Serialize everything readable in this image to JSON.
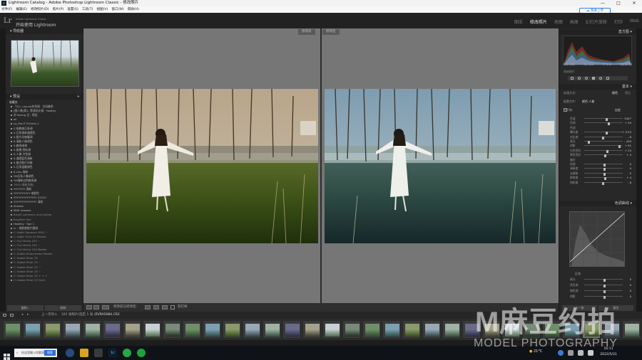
{
  "window": {
    "title": "Lightroom Catalog - Adobe Photoshop Lightroom Classic - 修改照片",
    "controls": [
      "—",
      "□",
      "✕"
    ]
  },
  "menu": [
    "文件(F)",
    "编辑(E)",
    "修改照片(D)",
    "照片(P)",
    "设置(S)",
    "工具(T)",
    "视图(V)",
    "窗口(W)",
    "帮助(H)"
  ],
  "cloud_button": "我要上传",
  "identity": {
    "logo": "Lr",
    "small": "Adobe Lightroom Classic",
    "plate": "开始使用 Lightroom"
  },
  "modules": [
    {
      "label": "图库",
      "active": false
    },
    {
      "label": "修改照片",
      "active": true
    },
    {
      "label": "地图",
      "active": false
    },
    {
      "label": "画册",
      "active": false
    },
    {
      "label": "幻灯片放映",
      "active": false
    },
    {
      "label": "打印",
      "active": false
    },
    {
      "label": "Web",
      "active": false
    }
  ],
  "left_panel": {
    "navigator_title": "导航器",
    "presets_title": "预设",
    "presets": [
      {
        "label": "收藏夹",
        "type": "head"
      },
      {
        "label": "『01』unsure灰色调 · 古风森系"
      },
      {
        "label": "[图人像]第1- 等调向文调 · Heathy"
      },
      {
        "label": "外·Spring 日 · 预设"
      },
      {
        "label": "ail"
      },
      {
        "label": "Lp_Pas P 010min-1"
      },
      {
        "label": "S-电影感日系调"
      },
      {
        "label": "S-日系清新通透色"
      },
      {
        "label": "S-胶片风格暖调"
      },
      {
        "label": "S-清新人像调色"
      },
      {
        "label": "S-森系绿调"
      },
      {
        "label": "S-夜景·霓虹调"
      },
      {
        "label": "S-人像 冷色调"
      },
      {
        "label": "S-通透蓝色清新"
      },
      {
        "label": "S-复古胶片风格"
      },
      {
        "label": "S-日系温暖调色"
      },
      {
        "label": "S-Lihs 清新"
      },
      {
        "label": "YM日系人像调色"
      },
      {
        "label": "YM清新自然森系调"
      },
      {
        "label": "TRO(Y清新风格)",
        "type": "dim"
      },
      {
        "label": "YYYYYYY 清新"
      },
      {
        "label": "YYYYYYYYYY 电影色"
      },
      {
        "label": "YYYYYYYYYYYYYY 22222"
      },
      {
        "label": "YYYYYYYYYYYYYY 清新"
      },
      {
        "label": "dhosbe"
      },
      {
        "label": "MAR remastr"
      },
      {
        "label": "Bright summery and bubhar",
        "type": "dim"
      },
      {
        "label": "Brighten feel",
        "type": "dim"
      },
      {
        "label": "Heathly · Spe 1"
      },
      {
        "label": "Lr - 电影感胶片暖调"
      },
      {
        "label": "C: eight Dapanse 0001 ~",
        "type": "dim"
      },
      {
        "label": "C: eight Olive 00 Master",
        "type": "dim"
      },
      {
        "label": "C: Fuji Velvia 100 ~",
        "type": "dim"
      },
      {
        "label": "C: Fuji Velvia 100 ~",
        "type": "dim"
      },
      {
        "label": "C: Fuji Velvia 100 Master",
        "type": "dim"
      },
      {
        "label": "C: Kodak Ektachrome Master",
        "type": "dim"
      },
      {
        "label": "C: Kodak Ektar 25",
        "type": "dim"
      },
      {
        "label": "C: Kodak Ektar 25 ~",
        "type": "dim"
      },
      {
        "label": "C: Kodak Ektar 25 ~",
        "type": "dim"
      },
      {
        "label": "C: Kodak Ektar 25 ~",
        "type": "dim"
      },
      {
        "label": "C: Kodak Ektar 25 + + +",
        "type": "dim"
      },
      {
        "label": "C: Kodak Ektar 25 Gold",
        "type": "dim"
      }
    ],
    "btn_copy": "复制...",
    "btn_paste": "粘贴"
  },
  "center": {
    "before_label": "修改前",
    "after_label": "修改后"
  },
  "toolbar": {
    "label": "修改前与修改后:",
    "soft_proof": "软打样"
  },
  "right_panel": {
    "histogram_title": "直方图",
    "histogram_readout": [
      "ISO 100",
      "61 mm",
      "f / 1.8",
      "1/250 秒"
    ],
    "original_photo": "原始照片",
    "basic_title": "基本",
    "treatment": "处理方式:",
    "color": "颜色",
    "bw": "黑白",
    "profile_label": "配置文件:",
    "profile_value": "颜色 人像",
    "wb_label": "白平衡:",
    "wb_value": "自定",
    "rows": [
      {
        "label": "色温",
        "value": "5457",
        "pos": 0.55
      },
      {
        "label": "色调",
        "value": "+ 94",
        "pos": 0.62
      },
      {
        "label": "色调",
        "value": "",
        "pos": 0
      },
      {
        "label": "曝光度",
        "value": "+ 0.53",
        "pos": 0.56
      },
      {
        "label": "对比度",
        "value": "- 6",
        "pos": 0.47
      },
      {
        "label": "高光",
        "value": "- 100",
        "pos": 0.1
      },
      {
        "label": "阴影",
        "value": "+ 91",
        "pos": 0.88
      },
      {
        "label": "白色色阶",
        "value": "+ 23",
        "pos": 0.58
      },
      {
        "label": "黑色色阶",
        "value": "+ 3",
        "pos": 0.52
      },
      {
        "label": "偏好",
        "value": "",
        "pos": 0
      },
      {
        "label": "纹理",
        "value": "0",
        "pos": 0.5
      },
      {
        "label": "清晰度",
        "value": "0",
        "pos": 0.5
      },
      {
        "label": "去朦胧",
        "value": "0",
        "pos": 0.5
      },
      {
        "label": "鲜艳度",
        "value": "+ 4",
        "pos": 0.52
      },
      {
        "label": "饱和度",
        "value": "- 6",
        "pos": 0.47
      }
    ],
    "curve_title": "色调曲线",
    "region_label": "区域",
    "region_rows": [
      {
        "label": "高光",
        "value": "0"
      },
      {
        "label": "亮色调",
        "value": "0"
      },
      {
        "label": "暗色调",
        "value": "0"
      },
      {
        "label": "阴影",
        "value": "0"
      }
    ],
    "btn_prev": "上一张",
    "btn_reset": "复位"
  },
  "filmstrip_bar": {
    "source": "上一次导入",
    "count": "181 张照片/选定 1 张",
    "filename": "/ZVRA5084.CR2"
  },
  "taskbar": {
    "search_placeholder": "在这里输入你要搜索的内容",
    "search_button": "搜索",
    "weather": "21°C",
    "time": "16:11",
    "date": "2022/5/31"
  },
  "watermark": {
    "main": "M麻豆约拍",
    "sub": "MODEL PHOTOGRAPHY"
  }
}
